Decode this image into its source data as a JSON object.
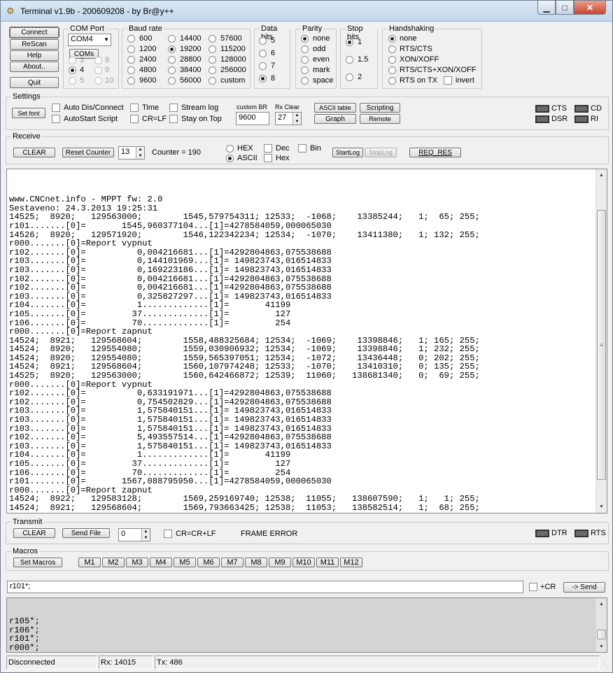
{
  "window": {
    "title": "Terminal v1.9b - 200609208 - by Br@y++",
    "minimize_glyph": "▁",
    "maximize_glyph": "□",
    "close_glyph": "✕"
  },
  "left_buttons": {
    "connect": "Connect",
    "rescan": "ReScan",
    "help": "Help",
    "about": "About..",
    "quit": "Quit"
  },
  "com_port": {
    "label": "COM Port",
    "selected": "COM4",
    "coms_button": "COMs",
    "radios": [
      "3",
      "4",
      "5",
      "8",
      "9",
      "10"
    ],
    "selected_radio": "4"
  },
  "baud_rate": {
    "label": "Baud rate",
    "options": [
      "600",
      "1200",
      "2400",
      "4800",
      "9600",
      "14400",
      "19200",
      "28800",
      "38400",
      "56000",
      "57600",
      "115200",
      "128000",
      "256000",
      "custom"
    ],
    "selected": "19200"
  },
  "data_bits": {
    "label": "Data bits",
    "options": [
      "5",
      "6",
      "7",
      "8"
    ],
    "selected": "8"
  },
  "parity": {
    "label": "Parity",
    "options": [
      "none",
      "odd",
      "even",
      "mark",
      "space"
    ],
    "selected": "none"
  },
  "stop_bits": {
    "label": "Stop bits",
    "options": [
      "1",
      "1.5",
      "2"
    ],
    "selected": "1"
  },
  "handshaking": {
    "label": "Handshaking",
    "options": [
      "none",
      "RTS/CTS",
      "XON/XOFF",
      "RTS/CTS+XON/XOFF",
      "RTS on TX"
    ],
    "selected": "none",
    "invert_label": "invert"
  },
  "settings": {
    "label": "Settings",
    "set_font": "Set font",
    "checks": {
      "auto_dis_connect": "Auto Dis/Connect",
      "autostart_script": "AutoStart Script",
      "time": "Time",
      "cr_lf": "CR=LF",
      "stream_log": "Stream log",
      "stay_on_top": "Stay on Top"
    },
    "custom_br_label": "custom BR",
    "custom_br_value": "9600",
    "rx_clear_label": "Rx Clear",
    "rx_clear_value": "27",
    "ascii_table": "ASCII table",
    "graph": "Graph",
    "scripting": "Scripting",
    "remote": "Remote",
    "leds": [
      "CTS",
      "CD",
      "DSR",
      "RI"
    ]
  },
  "receive": {
    "label": "Receive",
    "clear": "CLEAR",
    "reset_counter": "Reset Counter",
    "counter_spin": "13",
    "counter_text": "Counter = 190",
    "hex": "HEX",
    "ascii": "ASCII",
    "dec": "Dec",
    "hex_chk": "Hex",
    "bin": "Bin",
    "startlog": "StartLog",
    "stoplog": "StopLog",
    "req_res": "REQ_RES"
  },
  "terminal_lines": [
    "www.CNCnet.info - MPPT fw: 2.0",
    "Sestaveno: 24.3.2013 19:25:31",
    "14525;  8920;   129563000;        1545,579754311; 12533;  -1068;    13385244;   1;  65; 255;",
    "r101.......[0]=       1545,960377104...[1]=4278584059,000065030",
    "14526;  8920;   129571920;        1546,122342234; 12534;  -1070;    13411380;   1; 132; 255;",
    "r000.......[0]=Report vypnut",
    "r102.......[0]=          0,004216681...[1]=4292804863,075538688",
    "r103.......[0]=          0,144101969...[1]= 149823743,016514833",
    "r103.......[0]=          0,169223186...[1]= 149823743,016514833",
    "r102.......[0]=          0,004216681...[1]=4292804863,075538688",
    "r102.......[0]=          0,004216681...[1]=4292804863,075538688",
    "r103.......[0]=          0,325827297...[1]= 149823743,016514833",
    "r104.......[0]=          1.............[1]=       41199",
    "r105.......[0]=         37.............[1]=         127",
    "r106.......[0]=         70.............[1]=         254",
    "r000.......[0]=Report zapnut",
    "14524;  8921;   129568604;        1558,488325684; 12534;  -1069;    13398846;   1; 165; 255;",
    "14524;  8920;   129554080;        1559,030906932; 12534;  -1069;    13398846;   1; 232; 255;",
    "14524;  8920;   129554080;        1559,565397051; 12534;  -1072;    13436448;   0; 202; 255;",
    "14524;  8921;   129568604;        1560,107974248; 12533;  -1070;    13410310;   0; 135; 255;",
    "14525;  8920;   129563000;        1560,642466872; 12539;  11060;   138681340;   0;  69; 255;",
    "r000.......[0]=Report vypnut",
    "r102.......[0]=          0,633191971...[1]=4292804863,075538688",
    "r102.......[0]=          0,754502829...[1]=4292804863,075538688",
    "r103.......[0]=          1,575840151...[1]= 149823743,016514833",
    "r103.......[0]=          1,575840151...[1]= 149823743,016514833",
    "r103.......[0]=          1,575840151...[1]= 149823743,016514833",
    "r102.......[0]=          5,493557514...[1]=4292804863,075538688",
    "r103.......[0]=          1,575840151...[1]= 149823743,016514833",
    "r104.......[0]=          1.............[1]=       41199",
    "r105.......[0]=         37.............[1]=         127",
    "r106.......[0]=         70.............[1]=         254",
    "r101.......[0]=       1567,088795950...[1]=4278584059,000065030",
    "r000.......[0]=Report zapnut",
    "14524;  8922;   129583128;        1569,259169740; 12538;  11055;   138607590;   1;   1; 255;",
    "14524;  8921;   129568604;        1569,793663425; 12538;  11053;   138582514;   1;  68; 255;"
  ],
  "transmit": {
    "label": "Transmit",
    "clear": "CLEAR",
    "send_file": "Send File",
    "spin_value": "0",
    "cr_crlf": "CR=CR+LF",
    "frame_error": "FRAME ERROR",
    "leds": [
      "DTR",
      "RTS"
    ]
  },
  "macros": {
    "label": "Macros",
    "set_macros": "Set Macros",
    "buttons": [
      "M1",
      "M2",
      "M3",
      "M4",
      "M5",
      "M6",
      "M7",
      "M8",
      "M9",
      "M10",
      "M11",
      "M12"
    ]
  },
  "send_line": {
    "value": "r101*;",
    "plus_cr": "+CR",
    "send": "-> Send"
  },
  "history_lines": [
    "r105*;",
    "r106*;",
    "r101*;",
    "r000*;"
  ],
  "statusbar": {
    "state": "Disconnected",
    "rx": "Rx: 14015",
    "tx": "Tx: 486"
  }
}
